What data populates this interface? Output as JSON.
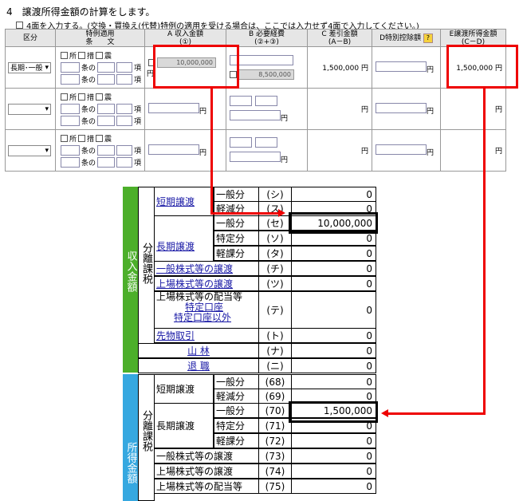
{
  "header": {
    "title": "4　譲渡所得金額の計算をします。",
    "option": "4面を入力する。(交換・買換え(代替)特例の適用を受ける場合は、ここでは入力せず4面で入力してください。)"
  },
  "table": {
    "headers": [
      "区分",
      "特例適用\n条　　文",
      "A 収入金額\n(①)",
      "B 必要経費\n(②+③)",
      "C 差引金額\n(A－B)",
      "D特別控除額",
      "E譲渡所得金額\n(C－D)"
    ],
    "checkbox_labels": [
      "所",
      "措",
      "震"
    ],
    "jo_no": "条の",
    "ko": "項",
    "yen": "円",
    "row1": {
      "kubun": "長期･一般",
      "a_value": "10,000,000",
      "b_value": "8,500,000",
      "c_value": "1,500,000",
      "e_value": "1,500,000"
    }
  },
  "ledger": {
    "income_title": "収入金額",
    "income_side": "分離課税",
    "shotoku_title": "所得金額",
    "shotoku_side": "分離課税",
    "tanki": "短期譲渡",
    "choki": "長期譲渡",
    "rows_income": [
      {
        "label": "一般分",
        "code": "(シ)",
        "value": "0"
      },
      {
        "label": "軽減分",
        "code": "(ス)",
        "value": "0"
      },
      {
        "label": "一般分",
        "code": "(セ)",
        "value": "10,000,000"
      },
      {
        "label": "特定分",
        "code": "(ソ)",
        "value": "0"
      },
      {
        "label": "軽課分",
        "code": "(タ)",
        "value": "0"
      },
      {
        "label": "一般株式等の譲渡",
        "code": "(チ)",
        "value": "0"
      },
      {
        "label": "上場株式等の譲渡",
        "code": "(ツ)",
        "value": "0"
      },
      {
        "label": "上場株式等の配当等",
        "sub1": "特定口座",
        "sub2": "特定口座以外",
        "code": "(テ)",
        "value": "0"
      },
      {
        "label": "先物取引",
        "code": "(ト)",
        "value": "0"
      },
      {
        "label": "山 林",
        "code": "(ナ)",
        "value": "0"
      },
      {
        "label": "退 職",
        "code": "(ニ)",
        "value": "0"
      }
    ],
    "rows_shotoku": [
      {
        "label": "一般分",
        "code": "(68)",
        "value": "0"
      },
      {
        "label": "軽減分",
        "code": "(69)",
        "value": "0"
      },
      {
        "label": "一般分",
        "code": "(70)",
        "value": "1,500,000"
      },
      {
        "label": "特定分",
        "code": "(71)",
        "value": "0"
      },
      {
        "label": "軽課分",
        "code": "(72)",
        "value": "0"
      },
      {
        "label": "一般株式等の譲渡",
        "code": "(73)",
        "value": "0"
      },
      {
        "label": "上場株式等の譲渡",
        "code": "(74)",
        "value": "0"
      },
      {
        "label": "上場株式等の配当等",
        "code": "(75)",
        "value": "0"
      }
    ]
  },
  "colors": {
    "income_bar": "#4caf2a",
    "shotoku_bar": "#36a8e0",
    "highlight": "#e00000"
  }
}
